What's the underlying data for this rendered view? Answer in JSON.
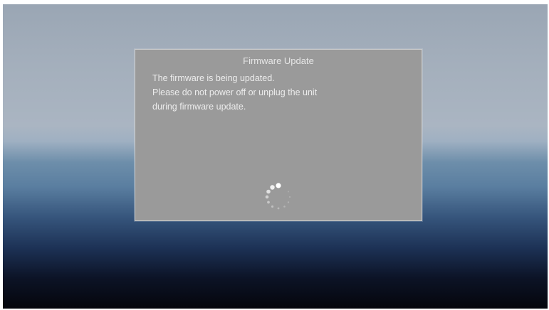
{
  "dialog": {
    "title": "Firmware Update",
    "message_lines": [
      "The firmware is being updated.",
      "Please do not power off or unplug the unit",
      "during firmware update."
    ],
    "spinner_icon": "loading-spinner-icon"
  },
  "colors": {
    "dialog_background": "#9a9a9a",
    "text": "#ececec"
  }
}
